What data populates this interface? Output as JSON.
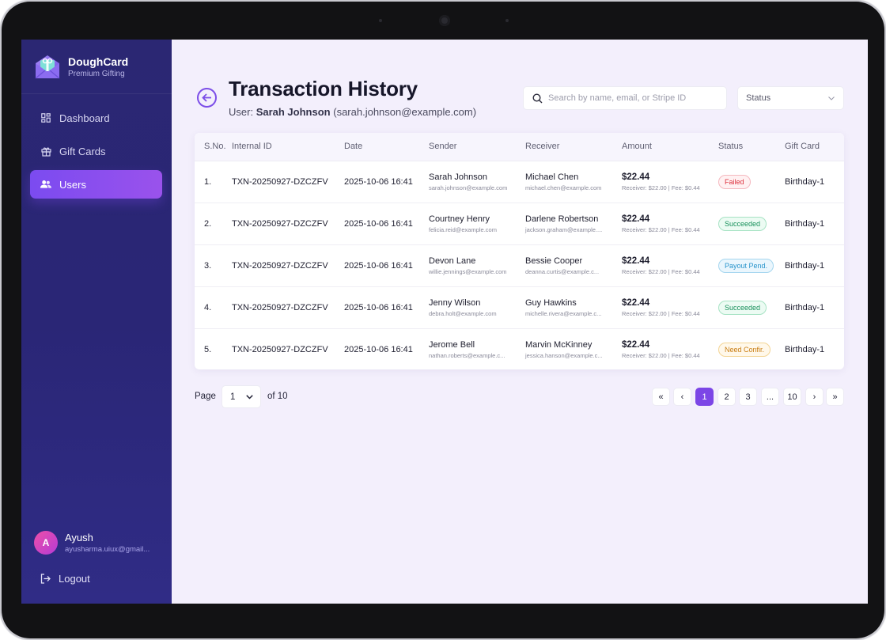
{
  "brand": {
    "name": "DoughCard",
    "tagline": "Premium Gifting"
  },
  "nav": [
    {
      "label": "Dashboard",
      "icon": "dashboard-icon",
      "active": false
    },
    {
      "label": "Gift Cards",
      "icon": "gift-icon",
      "active": false
    },
    {
      "label": "Users",
      "icon": "users-icon",
      "active": true
    }
  ],
  "profile": {
    "initial": "A",
    "name": "Ayush",
    "email": "ayusharma.uiux@gmail..."
  },
  "logout_label": "Logout",
  "header": {
    "title": "Transaction History",
    "user_prefix": "User:",
    "user_name": "Sarah Johnson",
    "user_email": "(sarah.johnson@example.com)"
  },
  "search": {
    "placeholder": "Search by name, email, or Stripe ID",
    "value": ""
  },
  "status_filter": {
    "label": "Status"
  },
  "table": {
    "columns": [
      "S.No.",
      "Internal ID",
      "Date",
      "Sender",
      "Receiver",
      "Amount",
      "Status",
      "Gift Card"
    ],
    "rows": [
      {
        "sno": "1.",
        "id": "TXN-20250927-DZCZFV",
        "date": "2025-10-06 16:41",
        "sender": "Sarah Johnson",
        "sender_email": "sarah.johnson@example.com",
        "receiver": "Michael Chen",
        "receiver_email": "michael.chen@example.com",
        "amount": "$22.44",
        "breakdown": "Receiver: $22.00 | Fee: $0.44",
        "status": "Failed",
        "status_type": "failed",
        "gift_card": "Birthday-1"
      },
      {
        "sno": "2.",
        "id": "TXN-20250927-DZCZFV",
        "date": "2025-10-06 16:41",
        "sender": "Courtney Henry",
        "sender_email": "felicia.reid@example.com",
        "receiver": "Darlene Robertson",
        "receiver_email": "jackson.graham@example....",
        "amount": "$22.44",
        "breakdown": "Receiver: $22.00 | Fee: $0.44",
        "status": "Succeeded",
        "status_type": "succeeded",
        "gift_card": "Birthday-1"
      },
      {
        "sno": "3.",
        "id": "TXN-20250927-DZCZFV",
        "date": "2025-10-06 16:41",
        "sender": "Devon Lane",
        "sender_email": "willie.jennings@example.com",
        "receiver": "Bessie Cooper",
        "receiver_email": "deanna.curtis@example.c...",
        "amount": "$22.44",
        "breakdown": "Receiver: $22.00 | Fee: $0.44",
        "status": "Payout Pend.",
        "status_type": "payout",
        "gift_card": "Birthday-1"
      },
      {
        "sno": "4.",
        "id": "TXN-20250927-DZCZFV",
        "date": "2025-10-06 16:41",
        "sender": "Jenny Wilson",
        "sender_email": "debra.holt@example.com",
        "receiver": "Guy Hawkins",
        "receiver_email": "michelle.rivera@example.c...",
        "amount": "$22.44",
        "breakdown": "Receiver: $22.00 | Fee: $0.44",
        "status": "Succeeded",
        "status_type": "succeeded",
        "gift_card": "Birthday-1"
      },
      {
        "sno": "5.",
        "id": "TXN-20250927-DZCZFV",
        "date": "2025-10-06 16:41",
        "sender": "Jerome Bell",
        "sender_email": "nathan.roberts@example.c...",
        "receiver": "Marvin McKinney",
        "receiver_email": "jessica.hanson@example.c...",
        "amount": "$22.44",
        "breakdown": "Receiver: $22.00 | Fee: $0.44",
        "status": "Need Confir.",
        "status_type": "need",
        "gift_card": "Birthday-1"
      }
    ]
  },
  "pagination": {
    "page_label": "Page",
    "current": "1",
    "of_label": "of 10",
    "buttons": [
      "«",
      "‹",
      "1",
      "2",
      "3",
      "...",
      "10",
      "›",
      "»"
    ],
    "active_index": 2
  },
  "colors": {
    "accent": "#7c46e6",
    "sidebar": "#2b2773",
    "background": "#f3effc"
  }
}
